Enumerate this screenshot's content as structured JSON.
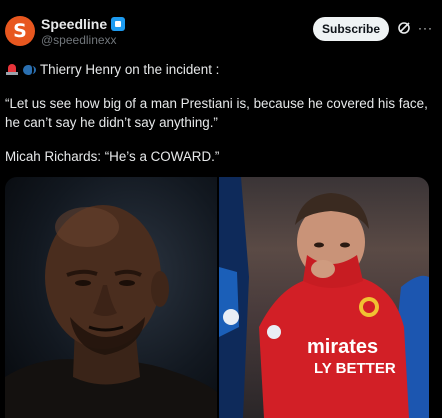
{
  "account": {
    "avatar_letter": "S",
    "display_name": "Speedline",
    "handle": "@speedlinexx",
    "brand_color": "#e8571f",
    "verified_color": "#1d9bf0"
  },
  "actions": {
    "subscribe_label": "Subscribe",
    "grok_icon": "grok-icon",
    "more_icon": "more-icon"
  },
  "tweet": {
    "line1": "Thierry Henry on the incident :",
    "line2": "“Let us see how big of a man Prestiani is, because he covered his face,",
    "line3": "he can’t say he didn’t say anything.”",
    "line4": "Micah Richards: “He’s a COWARD.”",
    "emojis": [
      "siren-icon",
      "speaking-head-icon"
    ]
  },
  "media": {
    "shirt_text_line1": "mirates",
    "shirt_text_line2": "LY BETTER"
  }
}
